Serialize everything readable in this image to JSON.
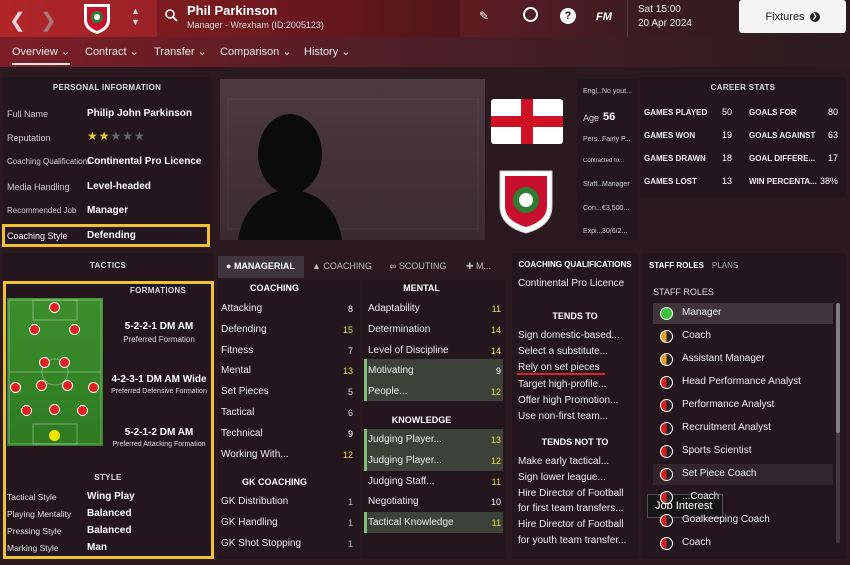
{
  "header": {
    "name": "Phil Parkinson",
    "subtitle": "Manager - Wrexham (ID:2005123)",
    "time": "Sat 15:00",
    "date": "20 Apr 2024",
    "fixtures": "Fixtures",
    "fm_label": "FM",
    "help_label": "?"
  },
  "tabs": [
    {
      "label": "Overview"
    },
    {
      "label": "Contract"
    },
    {
      "label": "Transfer"
    },
    {
      "label": "Comparison"
    },
    {
      "label": "History"
    }
  ],
  "personal": {
    "heading": "PERSONAL INFORMATION",
    "rows": [
      {
        "label": "Full Name",
        "value": "Philip John Parkinson"
      },
      {
        "label": "Reputation",
        "value": "",
        "stars": 2
      },
      {
        "label": "Coaching Qualifications",
        "value": "Continental Pro Licence"
      },
      {
        "label": "Media Handling",
        "value": "Level-headed"
      },
      {
        "label": "Recommended Job",
        "value": "Manager"
      },
      {
        "label": "Coaching Style",
        "value": "Defending"
      }
    ]
  },
  "info": {
    "rows": [
      {
        "label": "Engl...",
        "value": "No yout..."
      },
      {
        "label": "Age",
        "value": "56"
      },
      {
        "label": "Pers...",
        "value": "Fairly P..."
      },
      {
        "label": "Contracted to...",
        "value": ""
      },
      {
        "label": "Staff...",
        "value": "Manager"
      },
      {
        "label": "Con...",
        "value": "€3,500..."
      },
      {
        "label": "Expi...",
        "value": "30/6/2..."
      }
    ]
  },
  "career": {
    "heading": "CAREER STATS",
    "rows": [
      {
        "l1": "GAMES PLAYED",
        "v1": "50",
        "l2": "GOALS FOR",
        "v2": "80"
      },
      {
        "l1": "GAMES WON",
        "v1": "19",
        "l2": "GOALS AGAINST",
        "v2": "63"
      },
      {
        "l1": "GAMES DRAWN",
        "v1": "18",
        "l2": "GOAL DIFFERE...",
        "v2": "17"
      },
      {
        "l1": "GAMES LOST",
        "v1": "13",
        "l2": "WIN PERCENTA...",
        "v2": "38%"
      }
    ]
  },
  "tactics": {
    "heading": "TACTICS",
    "formations_heading": "FORMATIONS",
    "formations": [
      {
        "name": "5-2-2-1 DM AM",
        "sub": "Preferred Formation"
      },
      {
        "name": "4-2-3-1 DM AM Wide",
        "sub": "Preferred Defensive Formation"
      },
      {
        "name": "5-2-1-2 DM AM",
        "sub": "Preferred Attacking Formation"
      }
    ],
    "style_heading": "STYLE",
    "style": [
      {
        "label": "Tactical Style",
        "value": "Wing Play"
      },
      {
        "label": "Playing Mentality",
        "value": "Balanced"
      },
      {
        "label": "Pressing Style",
        "value": "Balanced"
      },
      {
        "label": "Marking Style",
        "value": "Man"
      }
    ]
  },
  "midtabs": [
    {
      "label": "MANAGERIAL"
    },
    {
      "label": "COACHING"
    },
    {
      "label": "SCOUTING"
    },
    {
      "label": "M..."
    }
  ],
  "attributes": {
    "coaching_heading": "COACHING",
    "coaching": [
      {
        "label": "Attacking",
        "value": "8"
      },
      {
        "label": "Defending",
        "value": "15"
      },
      {
        "label": "Fitness",
        "value": "7"
      },
      {
        "label": "Mental",
        "value": "13"
      },
      {
        "label": "Set Pieces",
        "value": "5"
      },
      {
        "label": "Tactical",
        "value": "6"
      },
      {
        "label": "Technical",
        "value": "9"
      },
      {
        "label": "Working With...",
        "value": "12"
      }
    ],
    "gk_heading": "GK COACHING",
    "gk": [
      {
        "label": "GK Distribution",
        "value": "1"
      },
      {
        "label": "GK Handling",
        "value": "1"
      },
      {
        "label": "GK Shot Stopping",
        "value": "1"
      }
    ],
    "mental_heading": "MENTAL",
    "mental": [
      {
        "label": "Adaptability",
        "value": "11"
      },
      {
        "label": "Determination",
        "value": "14"
      },
      {
        "label": "Level of Discipline",
        "value": "14"
      },
      {
        "label": "Motivating",
        "value": "9"
      },
      {
        "label": "People...",
        "value": "12"
      }
    ],
    "knowledge_heading": "KNOWLEDGE",
    "knowledge": [
      {
        "label": "Judging Player...",
        "value": "13"
      },
      {
        "label": "Judging Player...",
        "value": "12"
      },
      {
        "label": "Judging Staff...",
        "value": "11"
      },
      {
        "label": "Negotiating",
        "value": "10"
      },
      {
        "label": "Tactical Knowledge",
        "value": "11"
      }
    ]
  },
  "qualifications": {
    "heading": "COACHING QUALIFICATIONS",
    "value": "Continental Pro Licence",
    "tends_heading": "TENDS TO",
    "tends": [
      "Sign domestic-based...",
      "Select a substitute...",
      "Rely on set pieces",
      "Target high-profile...",
      "Offer high Promotion...",
      "Use non-first team..."
    ],
    "not_heading": "TENDS NOT TO",
    "not": [
      "Make early tactical...",
      "Sign lower league...",
      "Hire Director of Football",
      "for first team transfers...",
      "Hire Director of Football",
      "for youth team transfer..."
    ]
  },
  "staff": {
    "tab1": "STAFF ROLES",
    "tab2": "PLANS",
    "heading": "STAFF ROLES",
    "roles": [
      "Manager",
      "Coach",
      "Assistant Manager",
      "Head Performance Analyst",
      "Performance Analyst",
      "Recruitment Analyst",
      "Sports Scientist",
      "Set Piece Coach",
      "...Coach",
      "Goalkeeping Coach",
      "Coach"
    ],
    "tooltip": "Job Interest"
  },
  "colors": {
    "accent": "#f1c232",
    "green_attr": "#8fd15a",
    "yellow_attr": "#e8e03a",
    "red_link": "#e0202a"
  }
}
